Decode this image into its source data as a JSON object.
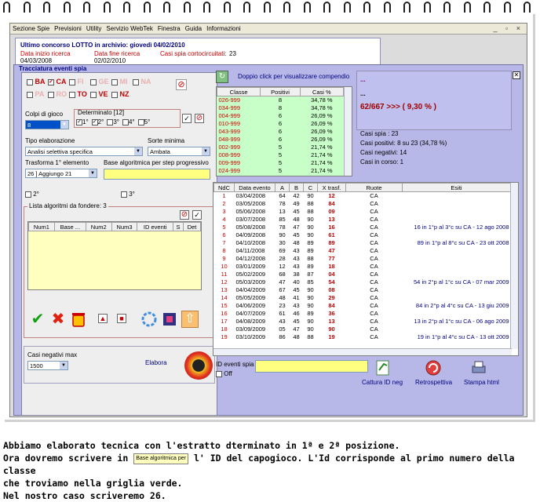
{
  "menu": [
    "Sezione Spie",
    "Previsioni",
    "Utility",
    "Servizio WebTek",
    "Finestra",
    "Guida",
    "Informazioni"
  ],
  "last_draw": {
    "title": "Ultimo concorso LOTTO in archivio: giovedì 04/02/2010",
    "start_label": "Data inizio ricerca",
    "start_value": "04/03/2008",
    "end_label": "Data fine ricerca",
    "end_value": "02/02/2010",
    "short_label": "Casi spia cortocircuitati:",
    "short_value": "23"
  },
  "frame_title": "Tracciatura eventi spia",
  "wheels": {
    "row1": [
      {
        "name": "BA",
        "checked": false,
        "active": true
      },
      {
        "name": "CA",
        "checked": true,
        "active": true
      },
      {
        "name": "FI",
        "checked": false,
        "active": false
      },
      {
        "name": "GE",
        "checked": false,
        "active": false
      },
      {
        "name": "MI",
        "checked": false,
        "active": false
      },
      {
        "name": "NA",
        "checked": false,
        "active": false
      }
    ],
    "row2": [
      {
        "name": "PA",
        "checked": false,
        "active": false
      },
      {
        "name": "RO",
        "checked": false,
        "active": false
      },
      {
        "name": "TO",
        "checked": false,
        "active": true
      },
      {
        "name": "VE",
        "checked": false,
        "active": true
      },
      {
        "name": "NZ",
        "checked": false,
        "active": true
      }
    ]
  },
  "colpi": {
    "label": "Colpi di gioco",
    "value": "8"
  },
  "determinato": {
    "label": "Determinato [12]",
    "opts": [
      "1°",
      "2°",
      "3°",
      "4°",
      "5°"
    ]
  },
  "tipo": {
    "label": "Tipo elaborazione",
    "value": "Analisi selettiva specifica"
  },
  "sorte": {
    "label": "Sorte minima",
    "value": "Ambata"
  },
  "trasforma": {
    "label": "Trasforma 1° elemento",
    "value": "26 ] Aggiungo 21"
  },
  "base_alg": {
    "label": "Base algoritmica per step progressivo",
    "value": ""
  },
  "opt2": "2°",
  "opt3": "3°",
  "lista": {
    "title": "Lista algoritmi da fondere: 3",
    "cols": [
      "Num1",
      "Base ...",
      "Num2",
      "Num3",
      "ID eventi",
      "S",
      "Det"
    ]
  },
  "casi_neg": {
    "label": "Casi negativi max",
    "value": "1500"
  },
  "elabora": "Elabora",
  "compendio": "Doppio click per visualizzare compendio",
  "class_table": {
    "cols": [
      "Classe",
      "Positivi",
      "Casi %"
    ],
    "rows": [
      [
        "026-999",
        "8",
        "34,78 %"
      ],
      [
        "034-999",
        "8",
        "34,78 %"
      ],
      [
        "004-999",
        "6",
        "26,09 %"
      ],
      [
        "010-999",
        "6",
        "26,09 %"
      ],
      [
        "043-999",
        "6",
        "26,09 %"
      ],
      [
        "048-999",
        "6",
        "26,09 %"
      ],
      [
        "002-999",
        "5",
        "21,74 %"
      ],
      [
        "008-999",
        "5",
        "21,74 %"
      ],
      [
        "009-999",
        "5",
        "21,74 %"
      ],
      [
        "024-999",
        "5",
        "21,74 %"
      ]
    ]
  },
  "stats": {
    "dots1": "...",
    "dots2": "...",
    "ratio": "62/667 >>> ( 9,30 % )",
    "casi_spia": "Casi spia : 23",
    "positivi": "Casi positivi: 8 su 23 (34,78 %)",
    "negativi": "Casi negativi: 14",
    "in_corso": "Casi in corso: 1"
  },
  "events": {
    "cols": [
      "NdC",
      "Data evento",
      "A",
      "B",
      "C",
      "X trasf.",
      "Ruote",
      "Esiti"
    ],
    "rows": [
      [
        "1",
        "03/04/2008",
        "64",
        "42",
        "90",
        "12",
        "CA",
        ""
      ],
      [
        "2",
        "03/05/2008",
        "78",
        "49",
        "88",
        "84",
        "CA",
        ""
      ],
      [
        "3",
        "05/06/2008",
        "13",
        "45",
        "88",
        "09",
        "CA",
        ""
      ],
      [
        "4",
        "03/07/2008",
        "85",
        "48",
        "90",
        "13",
        "CA",
        ""
      ],
      [
        "5",
        "05/08/2008",
        "78",
        "47",
        "90",
        "16",
        "CA",
        "16 in 1°p al 3°c su CA - 12 ago 2008"
      ],
      [
        "6",
        "04/09/2008",
        "90",
        "45",
        "90",
        "61",
        "CA",
        ""
      ],
      [
        "7",
        "04/10/2008",
        "30",
        "48",
        "89",
        "89",
        "CA",
        "89 in 1°p al 8°c su CA - 23 ott 2008"
      ],
      [
        "8",
        "04/11/2008",
        "69",
        "43",
        "89",
        "47",
        "CA",
        ""
      ],
      [
        "9",
        "04/12/2008",
        "28",
        "43",
        "88",
        "77",
        "CA",
        ""
      ],
      [
        "10",
        "03/01/2009",
        "12",
        "43",
        "89",
        "18",
        "CA",
        ""
      ],
      [
        "11",
        "05/02/2009",
        "68",
        "38",
        "87",
        "04",
        "CA",
        ""
      ],
      [
        "12",
        "05/03/2009",
        "47",
        "40",
        "85",
        "54",
        "CA",
        "54 in 2°p al 1°c su CA - 07 mar 2009"
      ],
      [
        "13",
        "04/04/2009",
        "67",
        "45",
        "90",
        "08",
        "CA",
        ""
      ],
      [
        "14",
        "05/05/2009",
        "48",
        "41",
        "90",
        "29",
        "CA",
        ""
      ],
      [
        "15",
        "04/06/2009",
        "23",
        "43",
        "90",
        "84",
        "CA",
        "84 in 2°p al 4°c su CA - 13 giu 2009"
      ],
      [
        "16",
        "04/07/2009",
        "61",
        "46",
        "89",
        "36",
        "CA",
        ""
      ],
      [
        "17",
        "04/08/2009",
        "43",
        "45",
        "90",
        "13",
        "CA",
        "13 in 2°p al 1°c su CA - 06 ago 2009"
      ],
      [
        "18",
        "03/09/2009",
        "05",
        "47",
        "90",
        "90",
        "CA",
        ""
      ],
      [
        "19",
        "03/10/2009",
        "86",
        "48",
        "88",
        "19",
        "CA",
        "19 in 1°p al 4°c su CA - 13 ott 2009"
      ]
    ]
  },
  "id_spia": {
    "label": "ID eventi spia",
    "off": "Off",
    "value": ""
  },
  "bottom_buttons": [
    "Cattura ID neg",
    "Retrospettiva",
    "Stampa html"
  ],
  "caption": {
    "line1": "Abbiamo elaborato tecnica con l'estratto dterminato in 1ª e 2ª posizione.",
    "line2a": "Ora dovremo scrivere in",
    "inline_label": "Base algoritmica per",
    "line2b": "l' ID del capogioco. L'Id corrisponde al primo numero della classe",
    "line3": "che troviamo nella griglia verde.",
    "line4": "Nel nostro caso scriveremo 26."
  },
  "colors": {
    "frame": "#b8b8e8",
    "green_grid": "#c8ffc8",
    "title_blue": "#000080",
    "yellow": "#ffff80",
    "class_text": "#cc0000"
  }
}
